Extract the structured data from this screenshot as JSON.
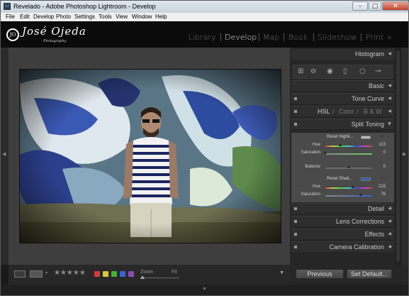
{
  "window": {
    "title": "Revelado - Adobe Photoshop Lightroom - Develop",
    "app_icon": "Lr",
    "controls": [
      "minimize",
      "maximize",
      "close"
    ]
  },
  "menu": [
    "File",
    "Edit",
    "Develop",
    "Photo",
    "Settings",
    "Tools",
    "View",
    "Window",
    "Help"
  ],
  "identity": {
    "logo_mark": "JO",
    "name": "José Ojeda",
    "tagline": "Photography"
  },
  "modules": [
    {
      "label": "Library",
      "active": false
    },
    {
      "label": "Develop",
      "active": true
    },
    {
      "label": "Map",
      "active": false
    },
    {
      "label": "Book",
      "active": false
    },
    {
      "label": "Slideshow",
      "active": false
    },
    {
      "label": "Print",
      "active": false
    }
  ],
  "modules_more": "»",
  "right_panels": {
    "histogram": "Histogram",
    "basic": "Basic",
    "tone_curve": "Tone Curve",
    "hsl": "HSL",
    "hsl_sep1": "/",
    "color": "Color",
    "hsl_sep2": "/",
    "bw": "B & W",
    "split_toning": "Split Toning",
    "detail": "Detail",
    "lens_corrections": "Lens Corrections",
    "effects": "Effects",
    "camera_calibration": "Camera Calibration"
  },
  "split_toning": {
    "highlights": {
      "reset_label": "Reset Highli...",
      "hue_label": "Hue",
      "hue": 113,
      "saturation_label": "Saturation",
      "saturation": 0,
      "color": "#b8b8b8"
    },
    "balance_label": "Balance",
    "balance": 0,
    "shadows": {
      "reset_label": "Reset Shad...",
      "hue_label": "Hue",
      "hue": 215,
      "saturation_label": "Saturation",
      "saturation": 76,
      "color": "#2f5fb0"
    }
  },
  "toolbar": {
    "stars": "★★★★★",
    "color_labels": [
      "#d63b3b",
      "#d8c832",
      "#4cae3c",
      "#3f63c9",
      "#8a4bb8"
    ],
    "zoom_label": "Zoom",
    "fit_label": "Fit",
    "menu_arrow": "▼"
  },
  "buttons": {
    "previous": "Previous",
    "set_default": "Set Default..."
  }
}
